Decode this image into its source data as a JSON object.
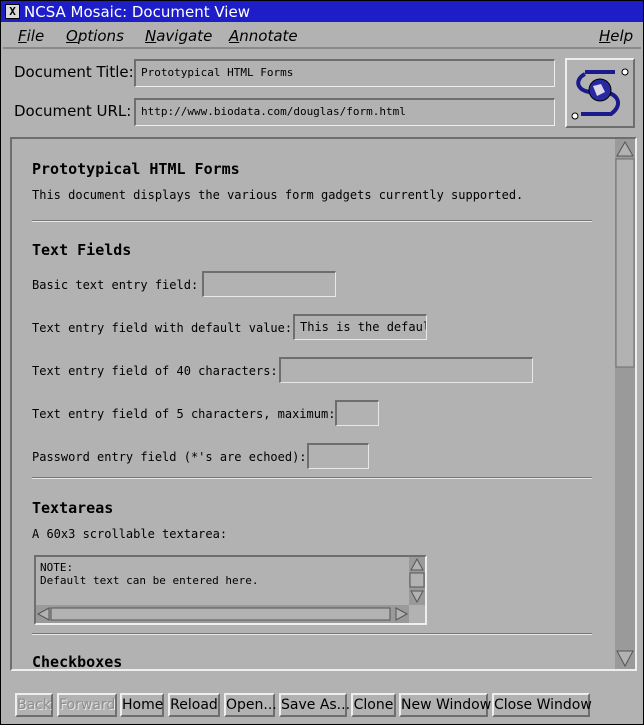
{
  "window": {
    "title": "NCSA Mosaic: Document View",
    "close_glyph": "X"
  },
  "menus": {
    "file": "File",
    "options": "Options",
    "navigate": "Navigate",
    "annotate": "Annotate",
    "help": "Help"
  },
  "header": {
    "title_label": "Document Title:",
    "title_value": "Prototypical HTML Forms",
    "url_label": "Document URL:",
    "url_value": "http://www.biodata.com/douglas/form.html",
    "logo_icon": "ncsa-globe-logo-icon"
  },
  "document": {
    "heading": "Prototypical HTML Forms",
    "intro": "This document displays the various form gadgets currently supported.",
    "text_fields": {
      "heading": "Text Fields",
      "basic_label": "Basic text entry field:",
      "basic_value": "",
      "default_label": "Text entry field with default value:",
      "default_value": "This is the default.",
      "forty_label": "Text entry field of 40 characters:",
      "forty_value": "",
      "five_label": "Text entry field of 5 characters, maximum:",
      "five_value": "",
      "password_label": "Password entry field (*'s are echoed):",
      "password_value": ""
    },
    "textareas": {
      "heading": "Textareas",
      "label": "A 60x3 scrollable textarea:",
      "value": "NOTE:\nDefault text can be entered here."
    },
    "checkboxes": {
      "heading": "Checkboxes"
    }
  },
  "buttons": {
    "back": "Back",
    "forward": "Forward",
    "home": "Home",
    "reload": "Reload",
    "open": "Open...",
    "save_as": "Save As...",
    "clone": "Clone",
    "new_window": "New Window",
    "close_window": "Close Window"
  },
  "colors": {
    "titlebar": "#1e1ec8",
    "chrome": "#b2b2b2",
    "trough": "#9a9a9a"
  }
}
